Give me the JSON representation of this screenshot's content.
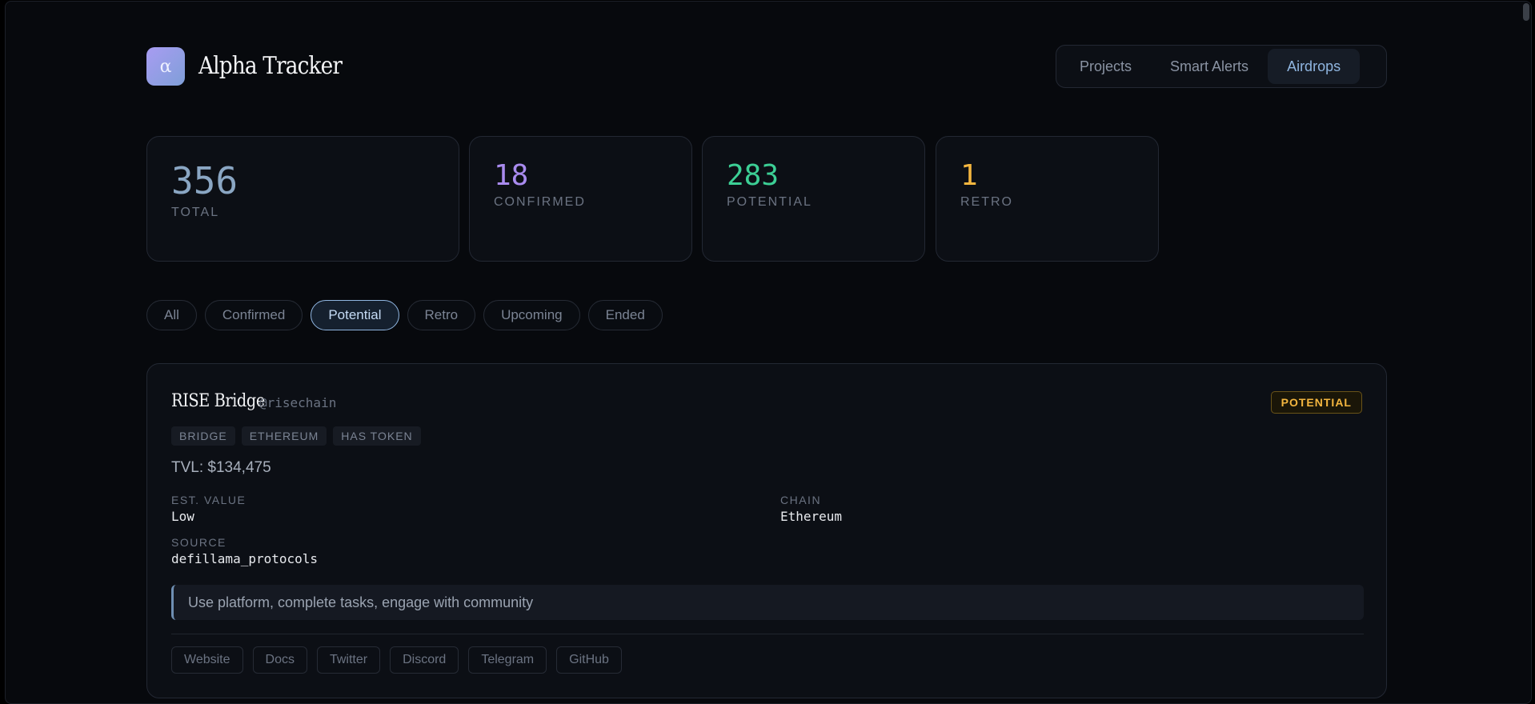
{
  "brand": {
    "logo_glyph": "α",
    "name": "Alpha Tracker"
  },
  "nav": {
    "items": [
      {
        "label": "Projects"
      },
      {
        "label": "Smart Alerts"
      },
      {
        "label": "Airdrops"
      }
    ],
    "active": "Airdrops"
  },
  "stats": [
    {
      "value": "356",
      "label": "Total",
      "color": "#8aa6c3"
    },
    {
      "value": "18",
      "label": "Confirmed",
      "color": "#a98bef"
    },
    {
      "value": "283",
      "label": "Potential",
      "color": "#3ccf95"
    },
    {
      "value": "1",
      "label": "Retro",
      "color": "#f4b63f"
    }
  ],
  "filters": {
    "items": [
      {
        "label": "All"
      },
      {
        "label": "Confirmed"
      },
      {
        "label": "Potential"
      },
      {
        "label": "Retro"
      },
      {
        "label": "Upcoming"
      },
      {
        "label": "Ended"
      }
    ],
    "active": "Potential"
  },
  "card": {
    "title": "RISE Bridge",
    "handle": "@risechain",
    "status": "POTENTIAL",
    "tags": [
      "BRIDGE",
      "ETHEREUM",
      "HAS TOKEN"
    ],
    "tvl": "TVL: $134,475",
    "est_value_label": "EST. VALUE",
    "est_value": "Low",
    "chain_label": "CHAIN",
    "chain": "Ethereum",
    "source_label": "SOURCE",
    "source": "defillama_protocols",
    "note": "Use platform, complete tasks, engage with community",
    "links": [
      "Website",
      "Docs",
      "Twitter",
      "Discord",
      "Telegram",
      "GitHub"
    ]
  }
}
